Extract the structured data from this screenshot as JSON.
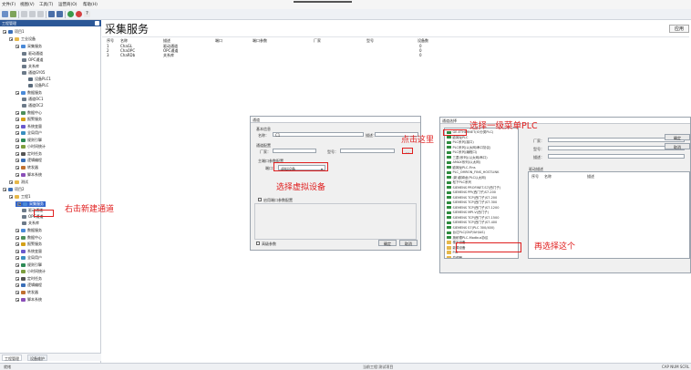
{
  "menu": {
    "items": [
      "文件(F)",
      "视图(V)",
      "工具(T)",
      "运营商(O)",
      "帮助(H)"
    ]
  },
  "toolbar": {
    "icons": [
      "new-icon",
      "open-icon",
      "cut-icon",
      "copy-icon",
      "paste-icon",
      "save-icon",
      "save-all-icon",
      "run-icon",
      "stop-icon",
      "help-icon"
    ]
  },
  "left_panel": {
    "header": "工程管理",
    "tree": [
      {
        "label": "项目1",
        "level": 0,
        "icon": "project-icon"
      },
      {
        "label": "工业设备",
        "level": 1,
        "icon": "folder-icon"
      },
      {
        "label": "采集服务",
        "level": 2,
        "icon": "service-icon"
      },
      {
        "label": "驱动通道",
        "level": 3,
        "icon": "channel-icon"
      },
      {
        "label": "OPC通道",
        "level": 3,
        "icon": "channel-icon"
      },
      {
        "label": "关系库",
        "level": 3,
        "icon": "channel-icon"
      },
      {
        "label": "通道GY05",
        "level": 3,
        "icon": "channel-icon"
      },
      {
        "label": "设备PLC1",
        "level": 4,
        "icon": "device-icon"
      },
      {
        "label": "设备PLC",
        "level": 4,
        "icon": "device-icon"
      },
      {
        "label": "数据服务",
        "level": 2,
        "icon": "service-icon"
      },
      {
        "label": "通道OC1",
        "level": 3,
        "icon": "channel-icon"
      },
      {
        "label": "通道OC2",
        "level": 3,
        "icon": "channel-icon"
      },
      {
        "label": "数据中心",
        "level": 2,
        "icon": "center-icon"
      },
      {
        "label": "报警服务",
        "level": 2,
        "icon": "alarm-icon"
      },
      {
        "label": "系统变量",
        "level": 2,
        "icon": "var-icon"
      },
      {
        "label": "全局用户",
        "level": 2,
        "icon": "user-icon"
      },
      {
        "label": "规则引擎",
        "level": 2,
        "icon": "rule-icon"
      },
      {
        "label": "小时间统计",
        "level": 2,
        "icon": "stat-icon"
      },
      {
        "label": "定时任务",
        "level": 2,
        "icon": "timer-icon"
      },
      {
        "label": "逻辑编程",
        "level": 2,
        "icon": "logic-icon"
      },
      {
        "label": "转发器",
        "level": 2,
        "icon": "forward-icon"
      },
      {
        "label": "脚本系统",
        "level": 2,
        "icon": "script-icon"
      },
      {
        "label": "测试",
        "level": 1,
        "icon": "folder-icon"
      },
      {
        "label": "项目2",
        "level": 0,
        "icon": "project-icon"
      },
      {
        "label": "工程1",
        "level": 1,
        "icon": "folder-icon"
      },
      {
        "label": "采集服务",
        "level": 2,
        "icon": "service-icon",
        "selected": true
      },
      {
        "label": "驱动通道",
        "level": 3,
        "icon": "channel-icon"
      },
      {
        "label": "OPC通道",
        "level": 3,
        "icon": "channel-icon"
      },
      {
        "label": "关系库",
        "level": 3,
        "icon": "channel-icon"
      },
      {
        "label": "数据服务",
        "level": 2,
        "icon": "service-icon"
      },
      {
        "label": "数据中心",
        "level": 2,
        "icon": "center-icon"
      },
      {
        "label": "报警服务",
        "level": 2,
        "icon": "alarm-icon"
      },
      {
        "label": "系统变量",
        "level": 2,
        "icon": "var-icon"
      },
      {
        "label": "全局用户",
        "level": 2,
        "icon": "user-icon"
      },
      {
        "label": "规则引擎",
        "level": 2,
        "icon": "rule-icon"
      },
      {
        "label": "小时间统计",
        "level": 2,
        "icon": "stat-icon"
      },
      {
        "label": "定时任务",
        "level": 2,
        "icon": "timer-icon"
      },
      {
        "label": "逻辑编程",
        "level": 2,
        "icon": "logic-icon"
      },
      {
        "label": "转发器",
        "level": 2,
        "icon": "forward-icon"
      },
      {
        "label": "脚本系统",
        "level": 2,
        "icon": "script-icon"
      }
    ],
    "tabs": [
      "工程管理",
      "设备维护"
    ]
  },
  "main": {
    "title": "采集服务",
    "apply_label": "应用",
    "columns": [
      "序号",
      "名称",
      "描述",
      "端口",
      "端口参数",
      "厂家",
      "型号",
      "设备数"
    ],
    "rows": [
      [
        "1",
        "ChaGL",
        "驱动通道",
        "",
        "",
        "",
        "",
        "0"
      ],
      [
        "2",
        "ChaOPC",
        "OPC通道",
        "",
        "",
        "",
        "",
        "0"
      ],
      [
        "3",
        "ChaRDb",
        "关系库",
        "",
        "",
        "",
        "",
        "0"
      ]
    ]
  },
  "channel_dialog": {
    "title": "通道",
    "basic_group": "基本信息",
    "name_label": "名称：",
    "name_value": "C1",
    "desc_label": "描述：",
    "param_group": "通道配置",
    "vendor_label": "厂家：",
    "model_label": "型号：",
    "port_group": "主端口参数配置",
    "port_label": "端口：",
    "port_value": "虚拟设备",
    "backup_label": "启用端口参数配置",
    "advanced_label": "高级参数",
    "ok_label": "确定",
    "cancel_label": "取消"
  },
  "plc_dialog": {
    "title": "通道选择",
    "items": [
      "GE-ETHERNET(IO分类PLC)",
      "欧姆龙PLC",
      "PLC系列(接口)",
      "PLC系列(以太网/串口协议)",
      "PLC系列(编程口)",
      "三菱(系列)(以太网/串口)",
      "AMAX系列(以太网)",
      "欧姆龙PLC-Fins",
      "PLC_OMRON_FINS_HOSTLINK",
      "(新)欧姆龙(PLC以太网)",
      "松下PLC系列",
      "SIEMENS PROFINET-S7(西门子)",
      "SIEMENS PPI(西门子)S7-200",
      "SIEMENS TCP(西门子)S7-200",
      "SIEMENS TCP(西门子)S7-300",
      "SIEMENS TCP(西门子)S7-1200",
      "SIEMENS MPI-V(西门子)",
      "SIEMENS TCP(西门子)S7-1500",
      "SIEMENS TCP(西门子)S7-400",
      "SIEMENS S7(PLC 300/400)",
      "台达PLC(DVP/AH/AS)",
      "施耐德PLC-Modbus协议"
    ],
    "folders": [
      "楼宇设备",
      "能源设备",
      "PID",
      "变频器",
      "门禁"
    ],
    "right_labels": [
      "厂家：",
      "型号：",
      "描述："
    ],
    "detail_group": "驱动描述",
    "detail_cols": [
      "序号",
      "名称",
      "描述"
    ],
    "btn_ok": "确定",
    "btn_cancel": "取消"
  },
  "annotations": {
    "right_click": "右击新建通道",
    "select_virtual": "选择虚拟设备",
    "click_here": "点击这里",
    "select_plc": "选择一级菜单PLC",
    "select_this": "再选择这个"
  },
  "status": {
    "left": "就绪",
    "center": "当前工程:测试项目",
    "right": "CAP NUM SCRL"
  },
  "colors": {
    "accent": "#2b5797",
    "selection": "#3366cc",
    "annotation": "#e02020",
    "plc_icon": "#2e8b3e"
  }
}
